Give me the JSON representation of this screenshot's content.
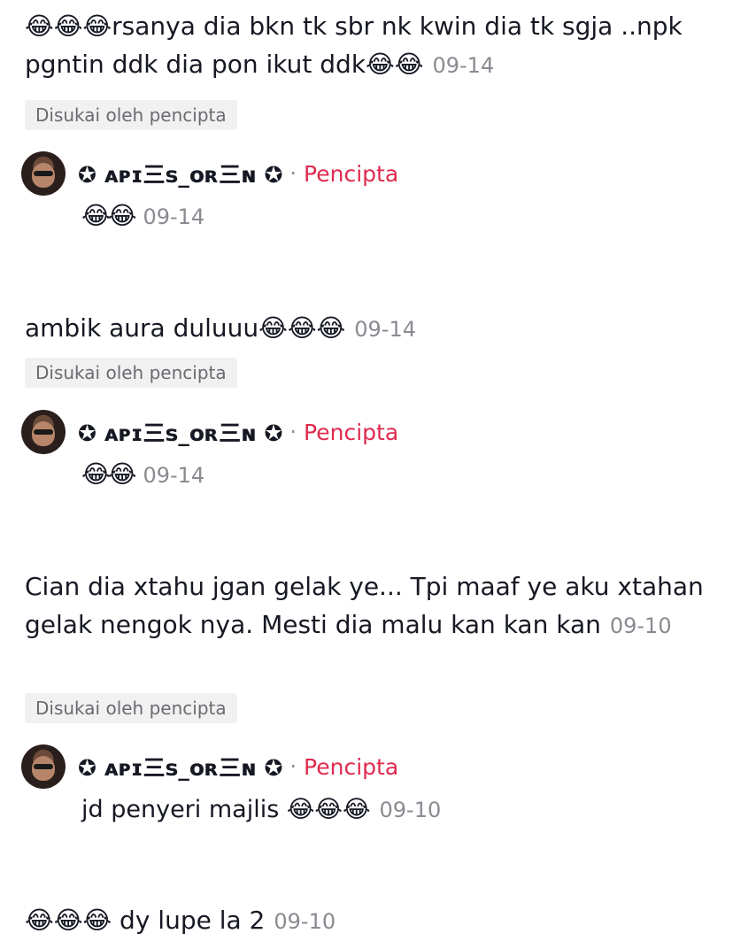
{
  "comments": [
    {
      "text": "😂😂😂rsanya dia bkn tk sbr nk kwin dia tk sgja ..npk pgntin ddk dia pon ikut ddk😂😂",
      "date": "09-14",
      "liked_label": "Disukai oleh pencipta",
      "reply": {
        "username": "✪ ᴀᴘɪ三ꜱ_ᴏʀ三ɴ ✪",
        "badge": "Pencipta",
        "text": "😂😂",
        "date": "09-14"
      }
    },
    {
      "text": "ambik aura duluuu😂😂😂",
      "date": "09-14",
      "liked_label": "Disukai oleh pencipta",
      "reply": {
        "username": "✪ ᴀᴘɪ三ꜱ_ᴏʀ三ɴ ✪",
        "badge": "Pencipta",
        "text": "😂😂",
        "date": "09-14"
      }
    },
    {
      "text": "Cian dia xtahu jgan gelak ye... Tpi maaf ye aku xtahan gelak nengok nya. Mesti dia malu kan kan kan",
      "date": "09-10",
      "liked_label": "Disukai oleh pencipta",
      "reply": {
        "username": "✪ ᴀᴘɪ三ꜱ_ᴏʀ三ɴ ✪",
        "badge": "Pencipta",
        "text": "jd penyeri majlis 😂😂😂",
        "date": "09-10"
      }
    },
    {
      "text": "😂😂😂 dy lupe la 2",
      "date": "09-10"
    }
  ],
  "reply_separator": "·"
}
